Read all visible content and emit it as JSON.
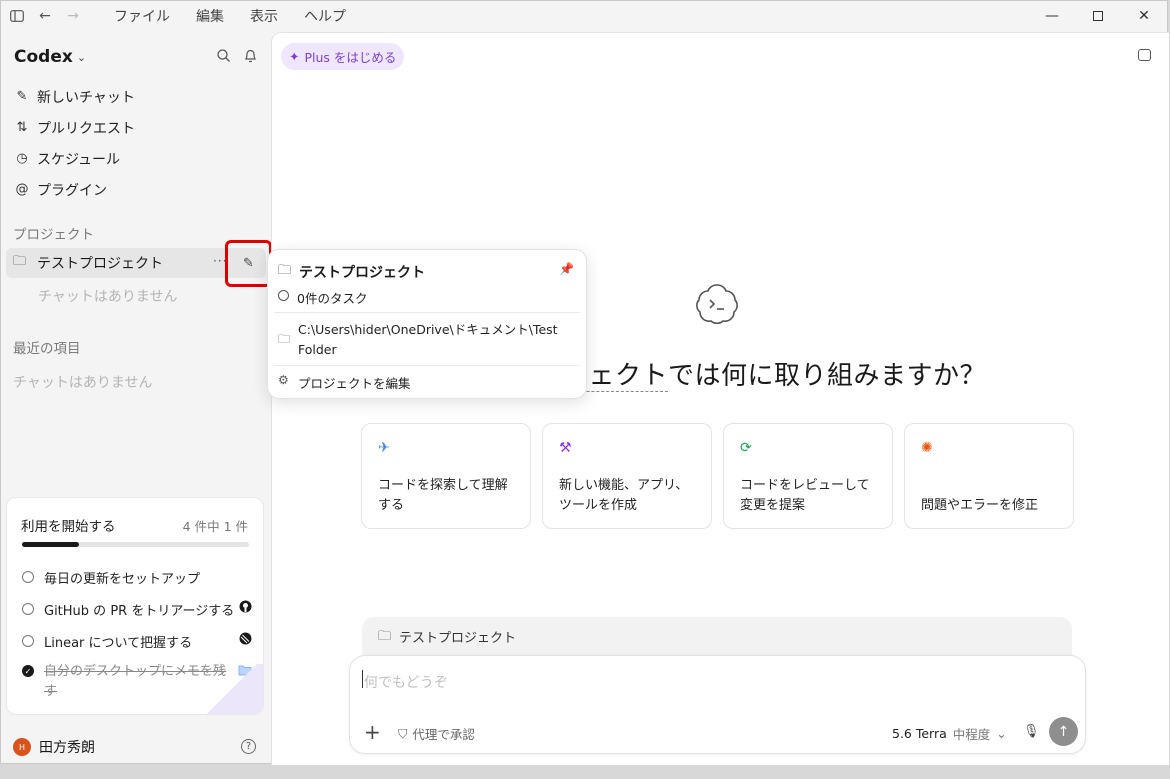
{
  "menubar": {
    "items": [
      "ファイル",
      "編集",
      "表示",
      "ヘルプ"
    ]
  },
  "sidebar": {
    "brand": "Codex",
    "nav": [
      {
        "label": "新しいチャット",
        "icon": "edit-icon"
      },
      {
        "label": "プルリクエスト",
        "icon": "pull-request-icon"
      },
      {
        "label": "スケジュール",
        "icon": "clock-icon"
      },
      {
        "label": "プラグイン",
        "icon": "at-icon"
      }
    ],
    "projects_label": "プロジェクト",
    "project_name": "テストプロジェクト",
    "project_empty": "チャットはありません",
    "recent_label": "最近の項目",
    "recent_empty": "チャットはありません",
    "getting_started": {
      "title": "利用を開始する",
      "count": "4 件中 1 件",
      "progress": 0.25,
      "items": [
        {
          "label": "毎日の更新をセットアップ",
          "done": false
        },
        {
          "label": "GitHub の PR をトリアージする",
          "done": false
        },
        {
          "label": "Linear について把握する",
          "done": false
        },
        {
          "label": "自分のデスクトップにメモを残す",
          "done": true
        }
      ]
    },
    "user": {
      "name": "田方秀朗",
      "initials": "H"
    }
  },
  "main": {
    "plus_button": "Plus をはじめる",
    "headline_underlined": "ジェクト",
    "headline_rest": "では何に取り組みますか？",
    "cards": [
      {
        "label": "コードを探索して理解する",
        "icon": "telescope-icon",
        "color": "#3b82f6"
      },
      {
        "label": "新しい機能、アプリ、ツールを作成",
        "icon": "hammer-icon",
        "color": "#9333ea"
      },
      {
        "label": "コードをレビューして変更を提案",
        "icon": "review-cycle-icon",
        "color": "#16a34a"
      },
      {
        "label": "問題やエラーを修正",
        "icon": "bug-icon",
        "color": "#ea580c"
      }
    ],
    "project_chip": "テストプロジェクト",
    "composer": {
      "placeholder": "何でもどうぞ",
      "approval": "代理で承認",
      "model": "5.6 Terra",
      "level": "中程度"
    }
  },
  "popup": {
    "title": "テストプロジェクト",
    "tasks": "0件のタスク",
    "path": "C:\\Users\\hider\\OneDrive\\ドキュメント\\Test Folder",
    "edit": "プロジェクトを編集"
  }
}
